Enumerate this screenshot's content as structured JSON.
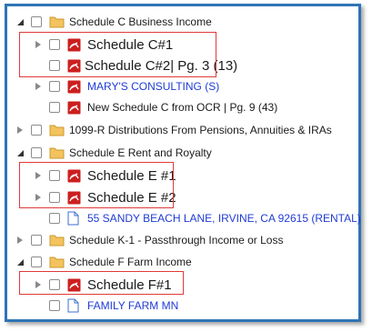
{
  "tree": {
    "rows": [
      {
        "label": "Schedule C Business Income"
      },
      {
        "label": "Schedule C#1"
      },
      {
        "label": "Schedule C#2| Pg. 3 (13)"
      },
      {
        "label": "MARY'S CONSULTING (S)"
      },
      {
        "label": "New Schedule C from OCR  | Pg. 9 (43)"
      },
      {
        "label": "1099-R  Distributions From Pensions, Annuities & IRAs"
      },
      {
        "label": "Schedule E  Rent and Royalty"
      },
      {
        "label": "Schedule E #1"
      },
      {
        "label": "Schedule E #2"
      },
      {
        "label": "55 SANDY BEACH LANE, IRVINE, CA 92615 (RENTAL)"
      },
      {
        "label": "Schedule K-1 - Passthrough Income or Loss"
      },
      {
        "label": "Schedule F Farm Income"
      },
      {
        "label": "Schedule F#1"
      },
      {
        "label": "FAMILY FARM MN"
      }
    ]
  },
  "colors": {
    "frame": "#2e74b5",
    "highlight": "#e03a3a",
    "link": "#1f3bd6",
    "folder": "#f3c35e",
    "pdf": "#cc1f1f"
  }
}
